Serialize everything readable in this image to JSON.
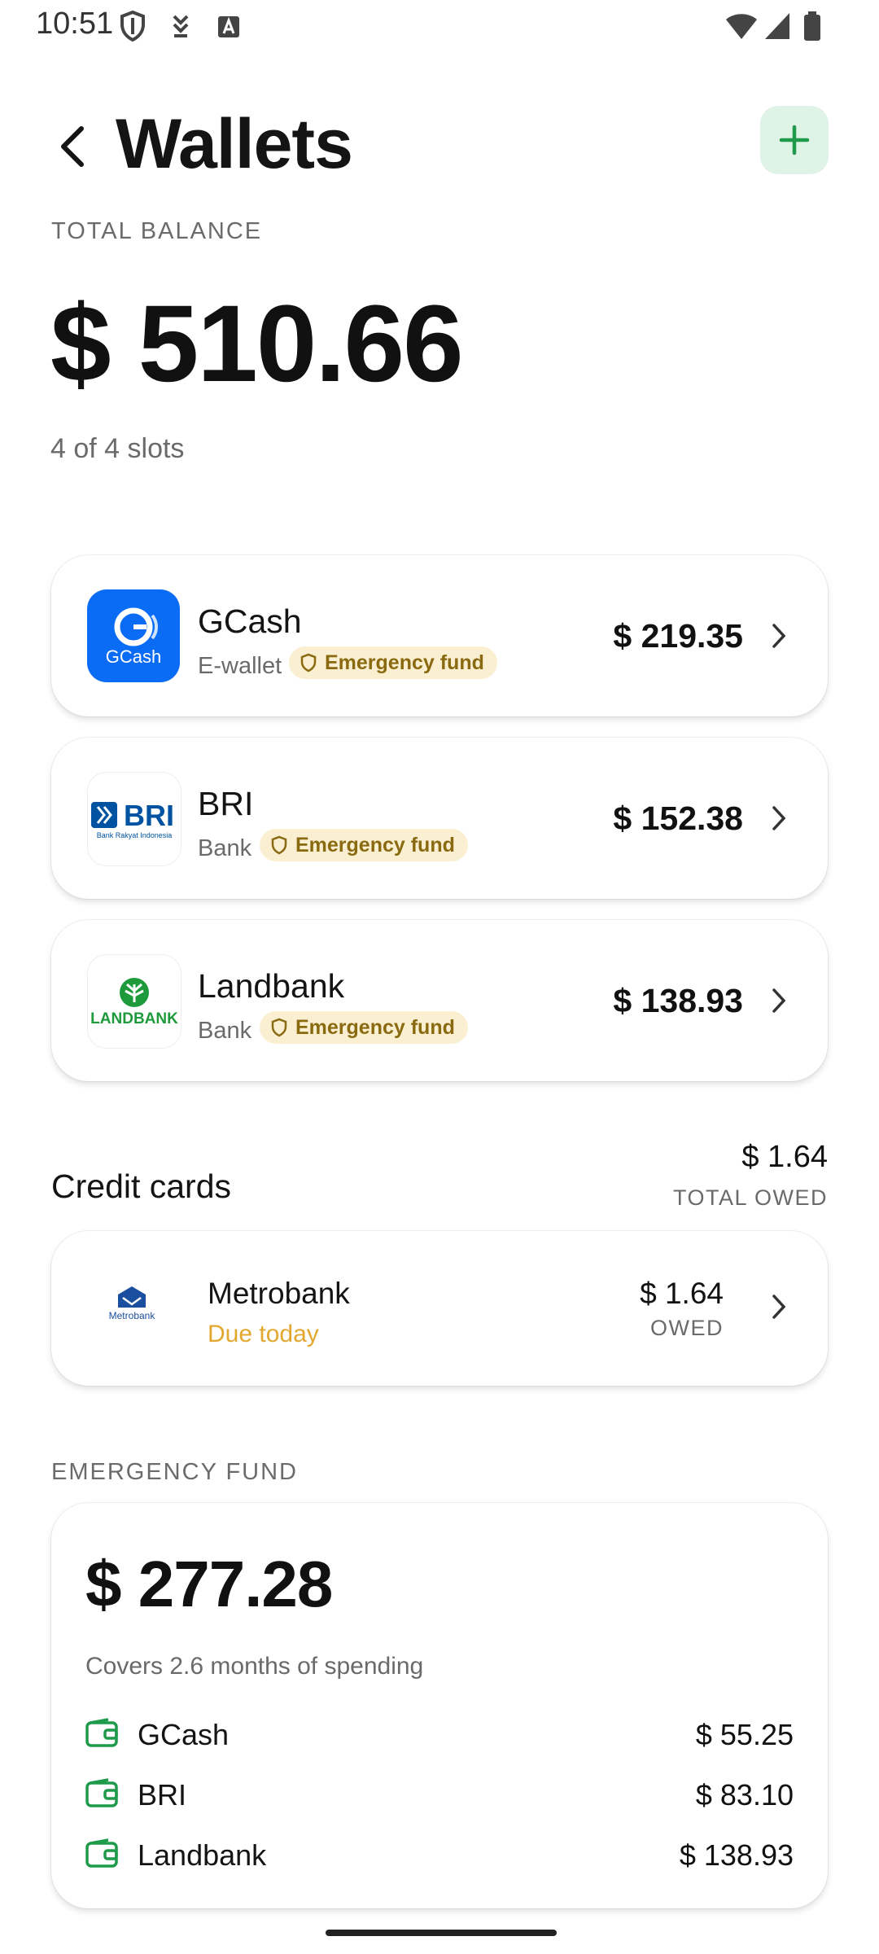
{
  "status": {
    "time": "10:51"
  },
  "header": {
    "title": "Wallets"
  },
  "balance": {
    "label": "TOTAL BALANCE",
    "amount": "$ 510.66",
    "slots": "4 of 4 slots"
  },
  "wallets": [
    {
      "name": "GCash",
      "type": "E-wallet",
      "badge": "Emergency fund",
      "amount": "$ 219.35",
      "logo_text": "GCash",
      "logo_color": "#0a6cf5"
    },
    {
      "name": "BRI",
      "type": "Bank",
      "badge": "Emergency fund",
      "amount": "$ 152.38",
      "logo_text": "BRI",
      "logo_sub": "Bank Rakyat Indonesia",
      "logo_color": "#0053a0"
    },
    {
      "name": "Landbank",
      "type": "Bank",
      "badge": "Emergency fund",
      "amount": "$ 138.93",
      "logo_text": "LANDBANK",
      "logo_color": "#1e9a3c"
    }
  ],
  "credit_cards": {
    "title": "Credit cards",
    "total": "$ 1.64",
    "total_label": "TOTAL OWED",
    "items": [
      {
        "name": "Metrobank",
        "status": "Due today",
        "amount": "$ 1.64",
        "owed_label": "OWED",
        "logo_text": "Metrobank"
      }
    ]
  },
  "emergency_fund": {
    "label": "EMERGENCY FUND",
    "amount": "$ 277.28",
    "covers": "Covers 2.6 months of spending",
    "rows": [
      {
        "name": "GCash",
        "amount": "$ 55.25"
      },
      {
        "name": "BRI",
        "amount": "$ 83.10"
      },
      {
        "name": "Landbank",
        "amount": "$ 138.93"
      }
    ]
  },
  "colors": {
    "accent_green": "#1e9a4a",
    "badge_bg": "#fbefd2",
    "badge_text": "#8a6a10",
    "due_text": "#e2a72e"
  }
}
